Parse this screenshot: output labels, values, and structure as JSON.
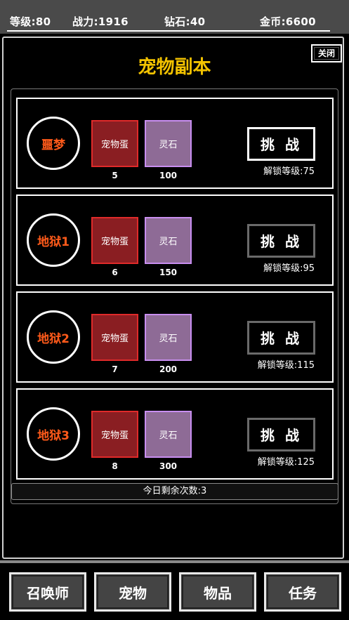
{
  "stats": {
    "level": "等级:80",
    "power": "战力:1916",
    "diamond": "钻石:40",
    "gold": "金币:6600"
  },
  "title": "宠物副本",
  "close_label": "关闭",
  "dungeons": [
    {
      "name": "噩梦",
      "egg_label": "宠物蛋",
      "egg_count": "5",
      "stone_label": "灵石",
      "stone_count": "100",
      "challenge_label": "挑 战",
      "unlock": "解锁等级:75",
      "state": "active"
    },
    {
      "name": "地狱1",
      "egg_label": "宠物蛋",
      "egg_count": "6",
      "stone_label": "灵石",
      "stone_count": "150",
      "challenge_label": "挑 战",
      "unlock": "解锁等级:95",
      "state": "locked"
    },
    {
      "name": "地狱2",
      "egg_label": "宠物蛋",
      "egg_count": "7",
      "stone_label": "灵石",
      "stone_count": "200",
      "challenge_label": "挑 战",
      "unlock": "解锁等级:115",
      "state": "locked"
    },
    {
      "name": "地狱3",
      "egg_label": "宠物蛋",
      "egg_count": "8",
      "stone_label": "灵石",
      "stone_count": "300",
      "challenge_label": "挑 战",
      "unlock": "解锁等级:125",
      "state": "locked"
    }
  ],
  "remaining": "今日剩余次数:3",
  "tabs": [
    "召唤师",
    "宠物",
    "物品",
    "任务"
  ],
  "colors": {
    "title": "#f2c200",
    "boss_name": "#ff5a1a",
    "egg": "#8a1e22",
    "stone": "#8e6b96"
  }
}
